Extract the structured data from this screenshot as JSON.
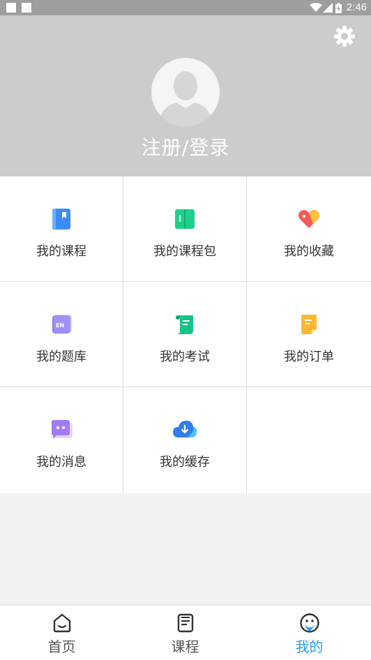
{
  "status_bar": {
    "time": "2:46"
  },
  "header": {
    "login_label": "注册/登录"
  },
  "menu": {
    "items": [
      {
        "label": "我的课程",
        "icon": "course-book-icon",
        "color": "#3d8cf6"
      },
      {
        "label": "我的课程包",
        "icon": "course-package-icon",
        "color": "#1fd08a"
      },
      {
        "label": "我的收藏",
        "icon": "favorites-heart-icon",
        "color": "#f45a5a"
      },
      {
        "label": "我的题库",
        "icon": "question-bank-icon",
        "color": "#8e7cf0"
      },
      {
        "label": "我的考试",
        "icon": "exam-scroll-icon",
        "color": "#17c488"
      },
      {
        "label": "我的订单",
        "icon": "order-note-icon",
        "color": "#ffb82e"
      },
      {
        "label": "我的消息",
        "icon": "message-bubble-icon",
        "color": "#9f7cf5"
      },
      {
        "label": "我的缓存",
        "icon": "cache-cloud-download-icon",
        "color": "#2f7ef2"
      }
    ]
  },
  "bottom_nav": {
    "items": [
      {
        "label": "首页",
        "icon": "home-icon",
        "active": false
      },
      {
        "label": "课程",
        "icon": "course-list-icon",
        "active": false
      },
      {
        "label": "我的",
        "icon": "profile-face-icon",
        "active": true
      }
    ],
    "active_color": "#2a9df4"
  }
}
